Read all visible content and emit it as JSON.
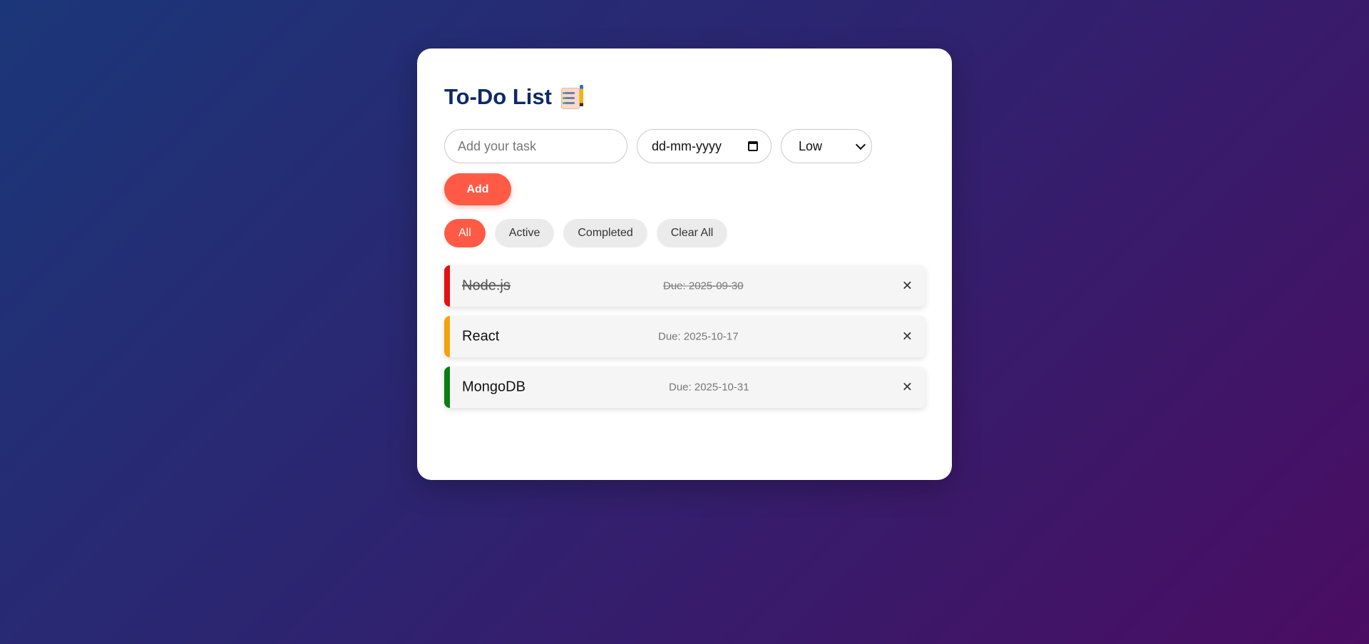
{
  "header": {
    "title": "To-Do List"
  },
  "form": {
    "task_placeholder": "Add your task",
    "date_value": "dd-mm-yyyy",
    "priority_selected": "Low",
    "add_label": "Add"
  },
  "filters": [
    {
      "label": "All",
      "active": true
    },
    {
      "label": "Active",
      "active": false
    },
    {
      "label": "Completed",
      "active": false
    },
    {
      "label": "Clear All",
      "active": false
    }
  ],
  "tasks": [
    {
      "name": "Node.js",
      "due": "Due: 2025-09-30",
      "priority": "high",
      "completed": true,
      "delete_label": "✕"
    },
    {
      "name": "React",
      "due": "Due: 2025-10-17",
      "priority": "medium",
      "completed": false,
      "delete_label": "✕"
    },
    {
      "name": "MongoDB",
      "due": "Due: 2025-10-31",
      "priority": "low",
      "completed": false,
      "delete_label": "✕"
    }
  ],
  "colors": {
    "accent": "#ff5a45",
    "title": "#0d2a66",
    "priority_high": "#e30f12",
    "priority_medium": "#f3a20f",
    "priority_low": "#0b7d12"
  }
}
